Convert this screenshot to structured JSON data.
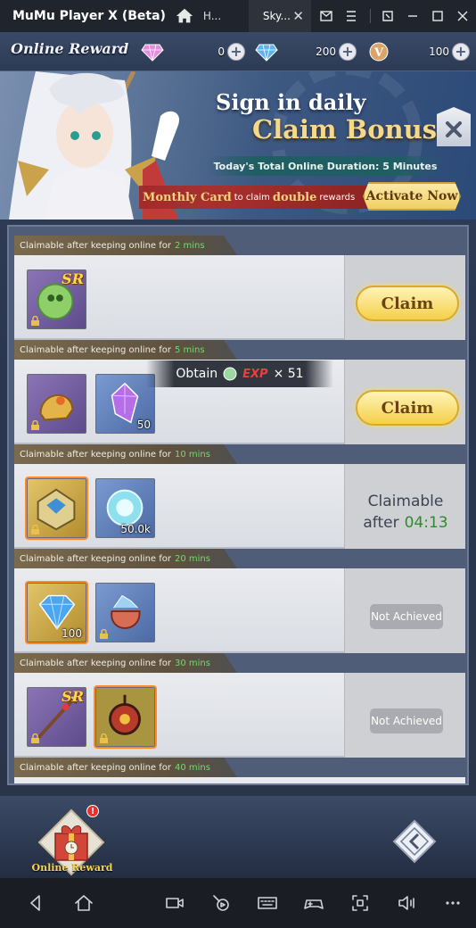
{
  "window": {
    "app_title": "MuMu Player X  (Beta)",
    "tabs": [
      {
        "label": "H..."
      },
      {
        "label": "Sky..."
      }
    ]
  },
  "header": {
    "panel_title": "Online Reward",
    "currencies": [
      {
        "icon": "pink-diamond-icon",
        "value": "0"
      },
      {
        "icon": "blue-diamond-icon",
        "value": "200"
      },
      {
        "icon": "v-coin-icon",
        "value": "100"
      }
    ]
  },
  "banner": {
    "line1": "Sign in daily",
    "line2": "Claim Bonus",
    "duration": "Today's Total Online Duration: 5 Minutes",
    "monthly_card": "Monthly Card",
    "monthly_mid": "to claim",
    "monthly_double": "double",
    "monthly_end": "rewards",
    "activate": "Activate Now"
  },
  "rows": [
    {
      "prefix": "Claimable after keeping online for",
      "mins": "2 mins",
      "state": "claim",
      "button": "Claim",
      "items": [
        {
          "icon": "green-orb-sr-icon",
          "qty": "",
          "sr": "SR"
        }
      ]
    },
    {
      "prefix": "Claimable after keeping online for",
      "mins": "5 mins",
      "state": "claim",
      "button": "Claim",
      "items": [
        {
          "icon": "golden-helm-icon",
          "qty": "",
          "sr": ""
        },
        {
          "icon": "purple-crystal-icon",
          "qty": "50",
          "sr": ""
        }
      ]
    },
    {
      "prefix": "Claimable after keeping online for",
      "mins": "10 mins",
      "state": "timer",
      "claimable": "Claimable",
      "after": "after",
      "time": "04:13",
      "items": [
        {
          "icon": "gold-chest-icon",
          "qty": "",
          "sr": ""
        },
        {
          "icon": "exp-orb-icon",
          "qty": "50.0k",
          "sr": ""
        }
      ]
    },
    {
      "prefix": "Claimable after keeping online for",
      "mins": "20 mins",
      "state": "locked",
      "button": "Not Achieved",
      "items": [
        {
          "icon": "blue-diamond-icon",
          "qty": "100",
          "sr": ""
        },
        {
          "icon": "gem-pouch-icon",
          "qty": "",
          "sr": ""
        }
      ]
    },
    {
      "prefix": "Claimable after keeping online for",
      "mins": "30 mins",
      "state": "locked",
      "button": "Not Achieved",
      "items": [
        {
          "icon": "spear-sr-icon",
          "qty": "",
          "sr": "SR"
        },
        {
          "icon": "red-relic-icon",
          "qty": "",
          "sr": ""
        }
      ]
    },
    {
      "prefix": "Claimable after keeping online for",
      "mins": "40 mins",
      "state": "partial",
      "items": []
    }
  ],
  "toast": {
    "label": "Obtain",
    "exp": "EXP",
    "count": "× 51"
  },
  "bottom": {
    "online_reward": "Online Reward",
    "badge": "!"
  },
  "colors": {
    "accent_gold": "#f5d04a",
    "timer_green": "#2f8a2f",
    "mins_green": "#6fdc6a",
    "exp_red": "#e8413c"
  }
}
